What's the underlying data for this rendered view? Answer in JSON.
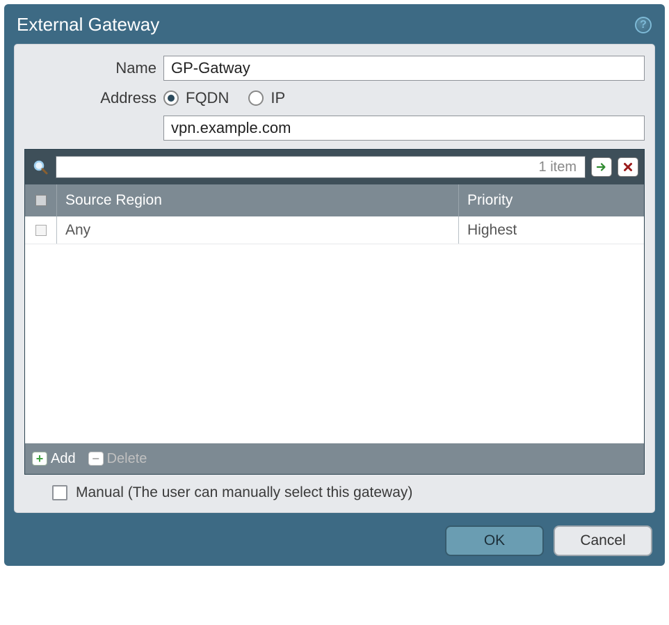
{
  "dialog": {
    "title": "External Gateway"
  },
  "form": {
    "name_label": "Name",
    "name_value": "GP-Gatway",
    "address_label": "Address",
    "address_value": "vpn.example.com",
    "fqdn_label": "FQDN",
    "ip_label": "IP",
    "address_type": "FQDN"
  },
  "grid": {
    "item_count_text": "1 item",
    "columns": {
      "source": "Source Region",
      "priority": "Priority"
    },
    "rows": [
      {
        "source": "Any",
        "priority": "Highest"
      }
    ],
    "add_label": "Add",
    "delete_label": "Delete"
  },
  "manual": {
    "label": "Manual (The user can manually select this gateway)",
    "checked": false
  },
  "buttons": {
    "ok": "OK",
    "cancel": "Cancel"
  }
}
